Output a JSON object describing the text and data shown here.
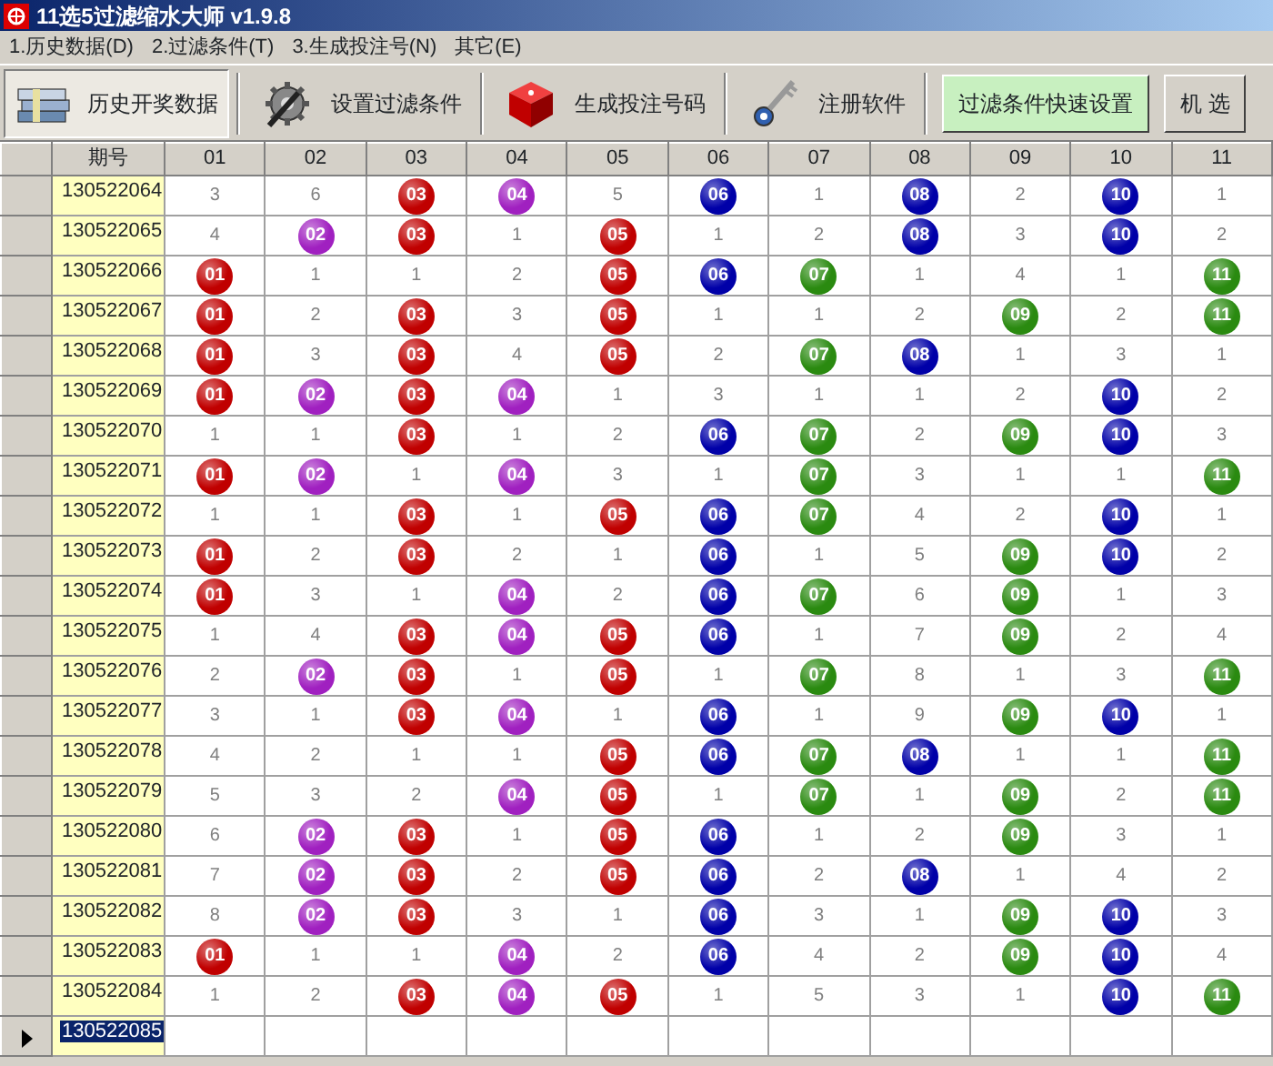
{
  "window": {
    "title": "11选5过滤缩水大师 v1.9.8"
  },
  "menu": [
    "1.历史数据(D)",
    "2.过滤条件(T)",
    "3.生成投注号(N)",
    "其它(E)"
  ],
  "toolbar": {
    "tools": [
      {
        "label": "历史开奖数据",
        "selected": true
      },
      {
        "label": "设置过滤条件",
        "selected": false
      },
      {
        "label": "生成投注号码",
        "selected": false
      },
      {
        "label": "注册软件",
        "selected": false
      }
    ],
    "buttons": [
      {
        "label": "过滤条件快速设置",
        "highlighted": true
      },
      {
        "label": "机 选",
        "highlighted": false
      }
    ]
  },
  "table": {
    "period_header": "期号",
    "columns": [
      {
        "label": "01",
        "color": "#c00000"
      },
      {
        "label": "02",
        "color": "#a020c0"
      },
      {
        "label": "03",
        "color": "#c00000"
      },
      {
        "label": "04",
        "color": "#a020c0"
      },
      {
        "label": "05",
        "color": "#c00000"
      },
      {
        "label": "06",
        "color": "#0000a8"
      },
      {
        "label": "07",
        "color": "#2a8a10"
      },
      {
        "label": "08",
        "color": "#0000a8"
      },
      {
        "label": "09",
        "color": "#2a8a10"
      },
      {
        "label": "10",
        "color": "#0000a8"
      },
      {
        "label": "11",
        "color": "#2a8a10"
      }
    ],
    "rows": [
      {
        "period": "130522064",
        "selected": false,
        "cells": [
          {
            "text": "3",
            "hit": false
          },
          {
            "text": "6",
            "hit": false
          },
          {
            "text": "03",
            "hit": true
          },
          {
            "text": "04",
            "hit": true
          },
          {
            "text": "5",
            "hit": false
          },
          {
            "text": "06",
            "hit": true
          },
          {
            "text": "1",
            "hit": false
          },
          {
            "text": "08",
            "hit": true
          },
          {
            "text": "2",
            "hit": false
          },
          {
            "text": "10",
            "hit": true
          },
          {
            "text": "1",
            "hit": false
          }
        ]
      },
      {
        "period": "130522065",
        "selected": false,
        "cells": [
          {
            "text": "4",
            "hit": false
          },
          {
            "text": "02",
            "hit": true
          },
          {
            "text": "03",
            "hit": true
          },
          {
            "text": "1",
            "hit": false
          },
          {
            "text": "05",
            "hit": true
          },
          {
            "text": "1",
            "hit": false
          },
          {
            "text": "2",
            "hit": false
          },
          {
            "text": "08",
            "hit": true
          },
          {
            "text": "3",
            "hit": false
          },
          {
            "text": "10",
            "hit": true
          },
          {
            "text": "2",
            "hit": false
          }
        ]
      },
      {
        "period": "130522066",
        "selected": false,
        "cells": [
          {
            "text": "01",
            "hit": true
          },
          {
            "text": "1",
            "hit": false
          },
          {
            "text": "1",
            "hit": false
          },
          {
            "text": "2",
            "hit": false
          },
          {
            "text": "05",
            "hit": true
          },
          {
            "text": "06",
            "hit": true
          },
          {
            "text": "07",
            "hit": true
          },
          {
            "text": "1",
            "hit": false
          },
          {
            "text": "4",
            "hit": false
          },
          {
            "text": "1",
            "hit": false
          },
          {
            "text": "11",
            "hit": true
          }
        ]
      },
      {
        "period": "130522067",
        "selected": false,
        "cells": [
          {
            "text": "01",
            "hit": true
          },
          {
            "text": "2",
            "hit": false
          },
          {
            "text": "03",
            "hit": true
          },
          {
            "text": "3",
            "hit": false
          },
          {
            "text": "05",
            "hit": true
          },
          {
            "text": "1",
            "hit": false
          },
          {
            "text": "1",
            "hit": false
          },
          {
            "text": "2",
            "hit": false
          },
          {
            "text": "09",
            "hit": true
          },
          {
            "text": "2",
            "hit": false
          },
          {
            "text": "11",
            "hit": true
          }
        ]
      },
      {
        "period": "130522068",
        "selected": false,
        "cells": [
          {
            "text": "01",
            "hit": true
          },
          {
            "text": "3",
            "hit": false
          },
          {
            "text": "03",
            "hit": true
          },
          {
            "text": "4",
            "hit": false
          },
          {
            "text": "05",
            "hit": true
          },
          {
            "text": "2",
            "hit": false
          },
          {
            "text": "07",
            "hit": true
          },
          {
            "text": "08",
            "hit": true
          },
          {
            "text": "1",
            "hit": false
          },
          {
            "text": "3",
            "hit": false
          },
          {
            "text": "1",
            "hit": false
          }
        ]
      },
      {
        "period": "130522069",
        "selected": false,
        "cells": [
          {
            "text": "01",
            "hit": true
          },
          {
            "text": "02",
            "hit": true
          },
          {
            "text": "03",
            "hit": true
          },
          {
            "text": "04",
            "hit": true
          },
          {
            "text": "1",
            "hit": false
          },
          {
            "text": "3",
            "hit": false
          },
          {
            "text": "1",
            "hit": false
          },
          {
            "text": "1",
            "hit": false
          },
          {
            "text": "2",
            "hit": false
          },
          {
            "text": "10",
            "hit": true
          },
          {
            "text": "2",
            "hit": false
          }
        ]
      },
      {
        "period": "130522070",
        "selected": false,
        "cells": [
          {
            "text": "1",
            "hit": false
          },
          {
            "text": "1",
            "hit": false
          },
          {
            "text": "03",
            "hit": true
          },
          {
            "text": "1",
            "hit": false
          },
          {
            "text": "2",
            "hit": false
          },
          {
            "text": "06",
            "hit": true
          },
          {
            "text": "07",
            "hit": true
          },
          {
            "text": "2",
            "hit": false
          },
          {
            "text": "09",
            "hit": true
          },
          {
            "text": "10",
            "hit": true
          },
          {
            "text": "3",
            "hit": false
          }
        ]
      },
      {
        "period": "130522071",
        "selected": false,
        "cells": [
          {
            "text": "01",
            "hit": true
          },
          {
            "text": "02",
            "hit": true
          },
          {
            "text": "1",
            "hit": false
          },
          {
            "text": "04",
            "hit": true
          },
          {
            "text": "3",
            "hit": false
          },
          {
            "text": "1",
            "hit": false
          },
          {
            "text": "07",
            "hit": true
          },
          {
            "text": "3",
            "hit": false
          },
          {
            "text": "1",
            "hit": false
          },
          {
            "text": "1",
            "hit": false
          },
          {
            "text": "11",
            "hit": true
          }
        ]
      },
      {
        "period": "130522072",
        "selected": false,
        "cells": [
          {
            "text": "1",
            "hit": false
          },
          {
            "text": "1",
            "hit": false
          },
          {
            "text": "03",
            "hit": true
          },
          {
            "text": "1",
            "hit": false
          },
          {
            "text": "05",
            "hit": true
          },
          {
            "text": "06",
            "hit": true
          },
          {
            "text": "07",
            "hit": true
          },
          {
            "text": "4",
            "hit": false
          },
          {
            "text": "2",
            "hit": false
          },
          {
            "text": "10",
            "hit": true
          },
          {
            "text": "1",
            "hit": false
          }
        ]
      },
      {
        "period": "130522073",
        "selected": false,
        "cells": [
          {
            "text": "01",
            "hit": true
          },
          {
            "text": "2",
            "hit": false
          },
          {
            "text": "03",
            "hit": true
          },
          {
            "text": "2",
            "hit": false
          },
          {
            "text": "1",
            "hit": false
          },
          {
            "text": "06",
            "hit": true
          },
          {
            "text": "1",
            "hit": false
          },
          {
            "text": "5",
            "hit": false
          },
          {
            "text": "09",
            "hit": true
          },
          {
            "text": "10",
            "hit": true
          },
          {
            "text": "2",
            "hit": false
          }
        ]
      },
      {
        "period": "130522074",
        "selected": false,
        "cells": [
          {
            "text": "01",
            "hit": true
          },
          {
            "text": "3",
            "hit": false
          },
          {
            "text": "1",
            "hit": false
          },
          {
            "text": "04",
            "hit": true
          },
          {
            "text": "2",
            "hit": false
          },
          {
            "text": "06",
            "hit": true
          },
          {
            "text": "07",
            "hit": true
          },
          {
            "text": "6",
            "hit": false
          },
          {
            "text": "09",
            "hit": true
          },
          {
            "text": "1",
            "hit": false
          },
          {
            "text": "3",
            "hit": false
          }
        ]
      },
      {
        "period": "130522075",
        "selected": false,
        "cells": [
          {
            "text": "1",
            "hit": false
          },
          {
            "text": "4",
            "hit": false
          },
          {
            "text": "03",
            "hit": true
          },
          {
            "text": "04",
            "hit": true
          },
          {
            "text": "05",
            "hit": true
          },
          {
            "text": "06",
            "hit": true
          },
          {
            "text": "1",
            "hit": false
          },
          {
            "text": "7",
            "hit": false
          },
          {
            "text": "09",
            "hit": true
          },
          {
            "text": "2",
            "hit": false
          },
          {
            "text": "4",
            "hit": false
          }
        ]
      },
      {
        "period": "130522076",
        "selected": false,
        "cells": [
          {
            "text": "2",
            "hit": false
          },
          {
            "text": "02",
            "hit": true
          },
          {
            "text": "03",
            "hit": true
          },
          {
            "text": "1",
            "hit": false
          },
          {
            "text": "05",
            "hit": true
          },
          {
            "text": "1",
            "hit": false
          },
          {
            "text": "07",
            "hit": true
          },
          {
            "text": "8",
            "hit": false
          },
          {
            "text": "1",
            "hit": false
          },
          {
            "text": "3",
            "hit": false
          },
          {
            "text": "11",
            "hit": true
          }
        ]
      },
      {
        "period": "130522077",
        "selected": false,
        "cells": [
          {
            "text": "3",
            "hit": false
          },
          {
            "text": "1",
            "hit": false
          },
          {
            "text": "03",
            "hit": true
          },
          {
            "text": "04",
            "hit": true
          },
          {
            "text": "1",
            "hit": false
          },
          {
            "text": "06",
            "hit": true
          },
          {
            "text": "1",
            "hit": false
          },
          {
            "text": "9",
            "hit": false
          },
          {
            "text": "09",
            "hit": true
          },
          {
            "text": "10",
            "hit": true
          },
          {
            "text": "1",
            "hit": false
          }
        ]
      },
      {
        "period": "130522078",
        "selected": false,
        "cells": [
          {
            "text": "4",
            "hit": false
          },
          {
            "text": "2",
            "hit": false
          },
          {
            "text": "1",
            "hit": false
          },
          {
            "text": "1",
            "hit": false
          },
          {
            "text": "05",
            "hit": true
          },
          {
            "text": "06",
            "hit": true
          },
          {
            "text": "07",
            "hit": true
          },
          {
            "text": "08",
            "hit": true
          },
          {
            "text": "1",
            "hit": false
          },
          {
            "text": "1",
            "hit": false
          },
          {
            "text": "11",
            "hit": true
          }
        ]
      },
      {
        "period": "130522079",
        "selected": false,
        "cells": [
          {
            "text": "5",
            "hit": false
          },
          {
            "text": "3",
            "hit": false
          },
          {
            "text": "2",
            "hit": false
          },
          {
            "text": "04",
            "hit": true
          },
          {
            "text": "05",
            "hit": true
          },
          {
            "text": "1",
            "hit": false
          },
          {
            "text": "07",
            "hit": true
          },
          {
            "text": "1",
            "hit": false
          },
          {
            "text": "09",
            "hit": true
          },
          {
            "text": "2",
            "hit": false
          },
          {
            "text": "11",
            "hit": true
          }
        ]
      },
      {
        "period": "130522080",
        "selected": false,
        "cells": [
          {
            "text": "6",
            "hit": false
          },
          {
            "text": "02",
            "hit": true
          },
          {
            "text": "03",
            "hit": true
          },
          {
            "text": "1",
            "hit": false
          },
          {
            "text": "05",
            "hit": true
          },
          {
            "text": "06",
            "hit": true
          },
          {
            "text": "1",
            "hit": false
          },
          {
            "text": "2",
            "hit": false
          },
          {
            "text": "09",
            "hit": true
          },
          {
            "text": "3",
            "hit": false
          },
          {
            "text": "1",
            "hit": false
          }
        ]
      },
      {
        "period": "130522081",
        "selected": false,
        "cells": [
          {
            "text": "7",
            "hit": false
          },
          {
            "text": "02",
            "hit": true
          },
          {
            "text": "03",
            "hit": true
          },
          {
            "text": "2",
            "hit": false
          },
          {
            "text": "05",
            "hit": true
          },
          {
            "text": "06",
            "hit": true
          },
          {
            "text": "2",
            "hit": false
          },
          {
            "text": "08",
            "hit": true
          },
          {
            "text": "1",
            "hit": false
          },
          {
            "text": "4",
            "hit": false
          },
          {
            "text": "2",
            "hit": false
          }
        ]
      },
      {
        "period": "130522082",
        "selected": false,
        "cells": [
          {
            "text": "8",
            "hit": false
          },
          {
            "text": "02",
            "hit": true
          },
          {
            "text": "03",
            "hit": true
          },
          {
            "text": "3",
            "hit": false
          },
          {
            "text": "1",
            "hit": false
          },
          {
            "text": "06",
            "hit": true
          },
          {
            "text": "3",
            "hit": false
          },
          {
            "text": "1",
            "hit": false
          },
          {
            "text": "09",
            "hit": true
          },
          {
            "text": "10",
            "hit": true
          },
          {
            "text": "3",
            "hit": false
          }
        ]
      },
      {
        "period": "130522083",
        "selected": false,
        "cells": [
          {
            "text": "01",
            "hit": true
          },
          {
            "text": "1",
            "hit": false
          },
          {
            "text": "1",
            "hit": false
          },
          {
            "text": "04",
            "hit": true
          },
          {
            "text": "2",
            "hit": false
          },
          {
            "text": "06",
            "hit": true
          },
          {
            "text": "4",
            "hit": false
          },
          {
            "text": "2",
            "hit": false
          },
          {
            "text": "09",
            "hit": true
          },
          {
            "text": "10",
            "hit": true
          },
          {
            "text": "4",
            "hit": false
          }
        ]
      },
      {
        "period": "130522084",
        "selected": false,
        "cells": [
          {
            "text": "1",
            "hit": false
          },
          {
            "text": "2",
            "hit": false
          },
          {
            "text": "03",
            "hit": true
          },
          {
            "text": "04",
            "hit": true
          },
          {
            "text": "05",
            "hit": true
          },
          {
            "text": "1",
            "hit": false
          },
          {
            "text": "5",
            "hit": false
          },
          {
            "text": "3",
            "hit": false
          },
          {
            "text": "1",
            "hit": false
          },
          {
            "text": "10",
            "hit": true
          },
          {
            "text": "11",
            "hit": true
          }
        ]
      },
      {
        "period": "130522085",
        "selected": true
      }
    ]
  }
}
